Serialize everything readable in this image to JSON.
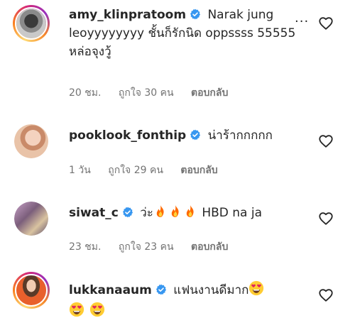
{
  "comments": [
    {
      "username": "amy_klinpratoom",
      "verified": true,
      "text": "Narak jung leoyyyyyyyy ชั้นก็รักนิด oppssss 55555 หล่อจุงวู้",
      "time": "20 ชม.",
      "likes": "ถูกใจ 30 คน",
      "reply": "ตอบกลับ",
      "more": "···"
    },
    {
      "username": "pooklook_fonthip",
      "verified": true,
      "text": "น่าร้ากกกกก",
      "time": "1 วัน",
      "likes": "ถูกใจ 29 คน",
      "reply": "ตอบกลับ"
    },
    {
      "username": "siwat_c",
      "verified": true,
      "text_before": "ว่ะ",
      "emojis": [
        "fire-emoji",
        "fire-emoji",
        "fire-emoji"
      ],
      "text_after": "HBD na ja",
      "time": "23 ชม.",
      "likes": "ถูกใจ 23 คน",
      "reply": "ตอบกลับ"
    },
    {
      "username": "lukkanaaum",
      "verified": true,
      "text": "แฟนงานดีมาก",
      "emojis": [
        "heart-eyes-emoji",
        "heart-eyes-emoji",
        "heart-eyes-emoji"
      ]
    }
  ],
  "colors": {
    "verified_blue": "#3897f0",
    "meta_gray": "#737373",
    "text": "#262626",
    "fire": "#ff6a00",
    "emoji_yellow": "#ffcc33"
  },
  "icons": {
    "heart": "heart-outline-icon",
    "verified": "verified-badge-icon",
    "more": "more-options-icon"
  }
}
